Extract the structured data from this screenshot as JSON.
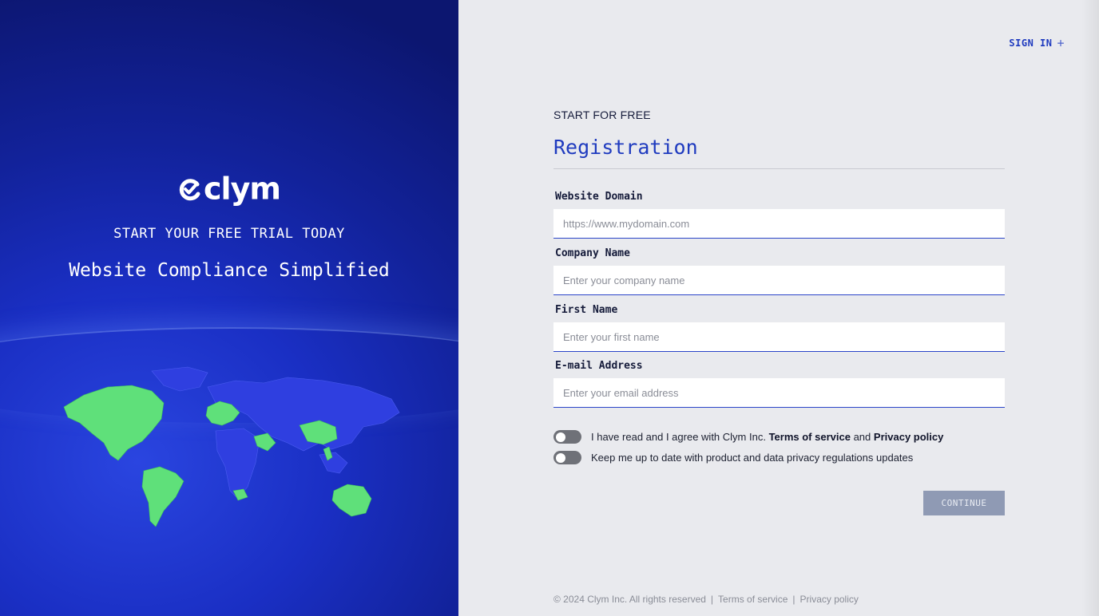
{
  "brand": {
    "name": "clym",
    "tagline": "START YOUR FREE TRIAL TODAY",
    "headline": "Website Compliance Simplified"
  },
  "header": {
    "signin_label": "SIGN IN",
    "signin_icon": "plus-icon"
  },
  "form": {
    "eyebrow": "START FOR FREE",
    "title": "Registration",
    "fields": [
      {
        "label": "Website Domain",
        "placeholder": "https://www.mydomain.com",
        "value": ""
      },
      {
        "label": "Company Name",
        "placeholder": "Enter your company name",
        "value": ""
      },
      {
        "label": "First Name",
        "placeholder": "Enter your first name",
        "value": ""
      },
      {
        "label": "E-mail Address",
        "placeholder": "Enter your email address",
        "value": ""
      }
    ],
    "agree": {
      "prefix": "I have read and I agree with Clym Inc.",
      "terms": "Terms of service",
      "and": "and",
      "privacy": "Privacy policy",
      "checked": false
    },
    "updates": {
      "label": "Keep me up to date with product and data privacy regulations updates",
      "checked": false
    },
    "continue_label": "CONTINUE"
  },
  "footer": {
    "copyright": "© 2024 Clym Inc. All rights reserved",
    "separator": "|",
    "terms": "Terms of service",
    "privacy": "Privacy policy"
  },
  "colors": {
    "accent": "#1f3bbf",
    "panel_blue": "#1a2fc4",
    "map_land": "#2f3fe0",
    "map_highlight": "#5fe07a",
    "button_disabled": "#8f9ab4"
  }
}
